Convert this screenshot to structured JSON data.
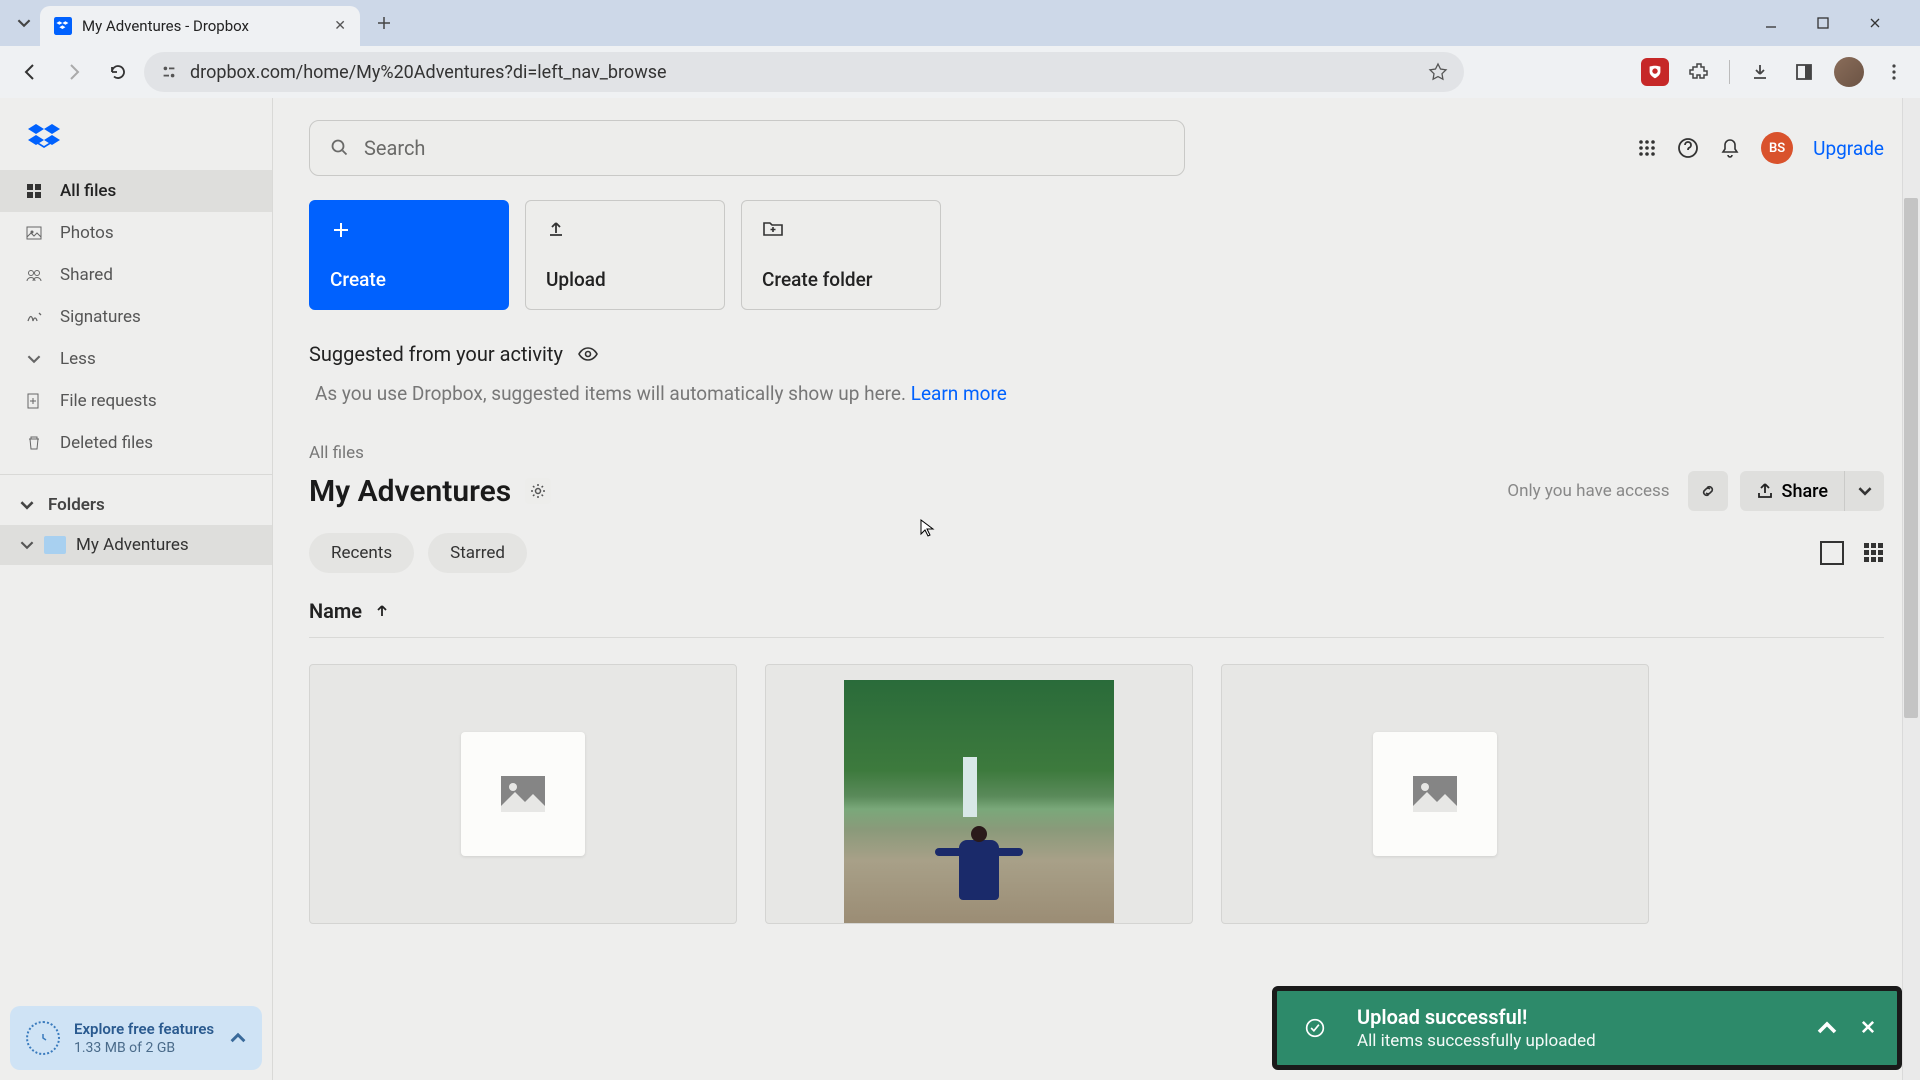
{
  "browser": {
    "tab_title": "My Adventures - Dropbox",
    "url": "dropbox.com/home/My%20Adventures?di=left_nav_browse"
  },
  "sidebar": {
    "items": [
      {
        "label": "All files"
      },
      {
        "label": "Photos"
      },
      {
        "label": "Shared"
      },
      {
        "label": "Signatures"
      },
      {
        "label": "Less"
      },
      {
        "label": "File requests"
      },
      {
        "label": "Deleted files"
      }
    ],
    "folders_header": "Folders",
    "folder_name": "My Adventures",
    "storage": {
      "title": "Explore free features",
      "usage": "1.33 MB of 2 GB"
    }
  },
  "header": {
    "search_placeholder": "Search",
    "avatar_initials": "BS",
    "upgrade": "Upgrade"
  },
  "actions": {
    "create": "Create",
    "upload": "Upload",
    "create_folder": "Create folder"
  },
  "suggested": {
    "heading": "Suggested from your activity",
    "body": "As you use Dropbox, suggested items will automatically show up here. ",
    "learn_more": "Learn more"
  },
  "breadcrumb": "All files",
  "folder": {
    "title": "My Adventures",
    "access": "Only you have access",
    "share": "Share"
  },
  "filters": {
    "recents": "Recents",
    "starred": "Starred"
  },
  "columns": {
    "name": "Name"
  },
  "toast": {
    "title": "Upload successful!",
    "sub": "All items successfully uploaded"
  }
}
